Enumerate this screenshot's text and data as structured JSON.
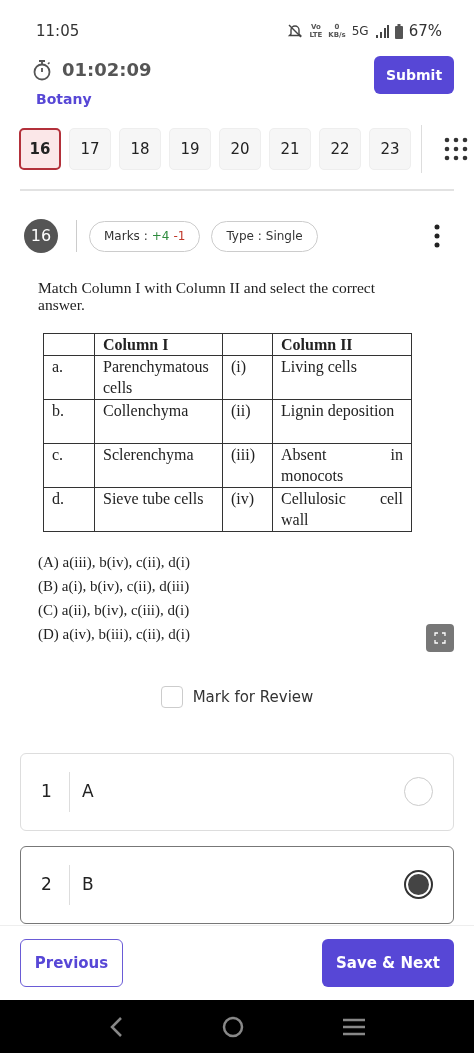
{
  "status_bar": {
    "time": "11:05",
    "volte_top": "Vo",
    "volte_bottom": "LTE",
    "speed_value": "0",
    "speed_unit": "KB/s",
    "network": "5G",
    "battery": "67%"
  },
  "header": {
    "timer": "01:02:09",
    "subject": "Botany",
    "submit": "Submit"
  },
  "question_nav": [
    {
      "label": "16",
      "selected": true
    },
    {
      "label": "17",
      "selected": false
    },
    {
      "label": "18",
      "selected": false
    },
    {
      "label": "19",
      "selected": false
    },
    {
      "label": "20",
      "selected": false
    },
    {
      "label": "21",
      "selected": false
    },
    {
      "label": "22",
      "selected": false
    },
    {
      "label": "23",
      "selected": false
    }
  ],
  "question": {
    "number": "16",
    "marks_label": "Marks :",
    "marks_plus": "+4",
    "marks_minus": "-1",
    "type_label": "Type :",
    "type_value": "Single",
    "text": "Match Column I with Column II and select the correct answer.",
    "table": {
      "columns": [
        "",
        "Column I",
        "",
        "Column II"
      ],
      "rows": [
        [
          "a.",
          "Parenchymatous cells",
          "(i)",
          "Living cells"
        ],
        [
          "b.",
          "Collenchyma",
          "(ii)",
          "Lignin deposition"
        ],
        [
          "c.",
          "Sclerenchyma",
          "(iii)",
          "Absent in monocots"
        ],
        [
          "d.",
          "Sieve tube cells",
          "(iv)",
          "Cellulosic cell wall"
        ]
      ]
    },
    "options": [
      "(A) a(iii), b(iv), c(ii), d(i)",
      "(B) a(i), b(iv), c(ii), d(iii)",
      "(C) a(ii), b(iv), c(iii), d(i)",
      "(D) a(iv), b(iii), c(ii), d(i)"
    ]
  },
  "mark_for_review": {
    "label": "Mark for Review",
    "checked": false
  },
  "answers": [
    {
      "number": "1",
      "label": "A",
      "selected": false
    },
    {
      "number": "2",
      "label": "B",
      "selected": true
    }
  ],
  "footer": {
    "previous": "Previous",
    "next": "Save & Next"
  }
}
